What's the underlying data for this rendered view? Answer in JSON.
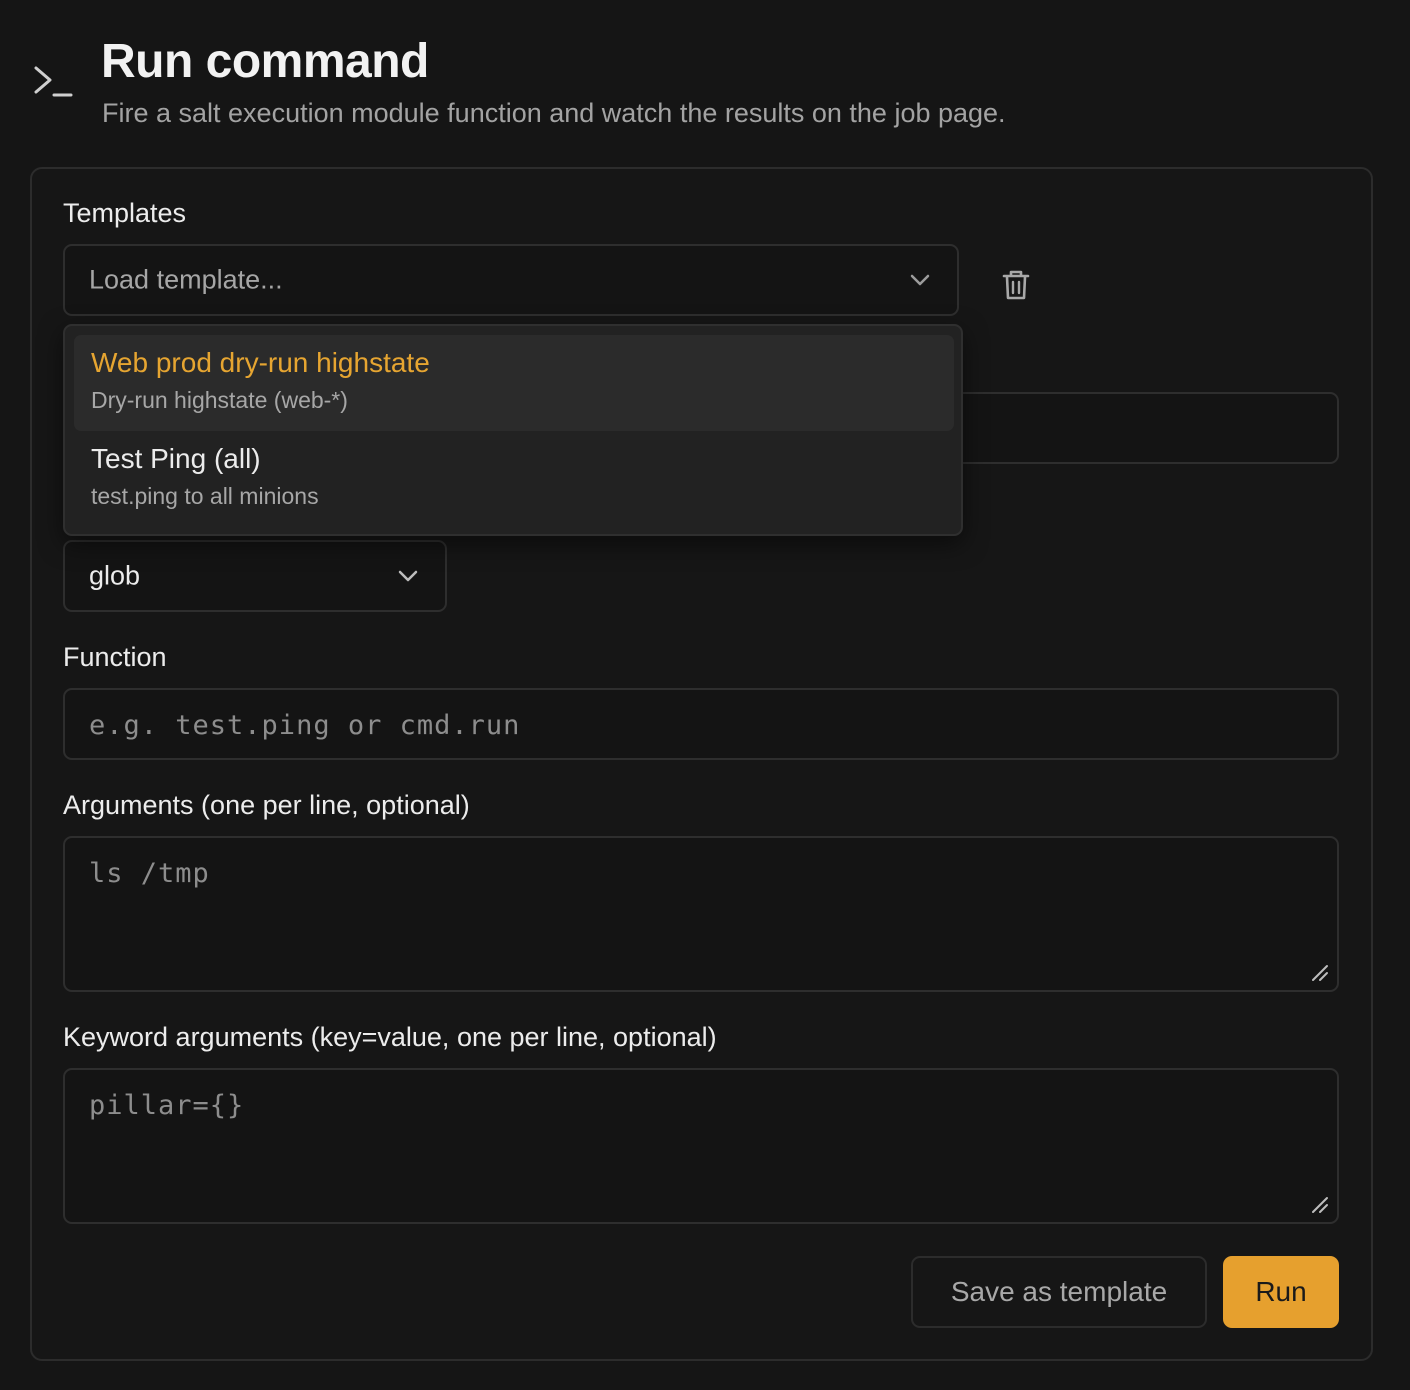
{
  "header": {
    "icon": "terminal-prompt-icon",
    "title": "Run command",
    "subtitle": "Fire a salt execution module function and watch the results on the job page."
  },
  "templates": {
    "label": "Templates",
    "select_placeholder": "Load template...",
    "delete_icon": "trash-icon",
    "dropdown_open": true,
    "options": [
      {
        "title": "Web prod dry-run highstate",
        "description": "Dry-run highstate (web-*)",
        "highlighted": true
      },
      {
        "title": "Test Ping (all)",
        "description": "test.ping to all minions",
        "highlighted": false
      }
    ]
  },
  "target_type": {
    "value": "glob"
  },
  "function": {
    "label": "Function",
    "placeholder": "e.g. test.ping or cmd.run"
  },
  "arguments": {
    "label": "Arguments (one per line, optional)",
    "placeholder": "ls /tmp"
  },
  "kwargs": {
    "label": "Keyword arguments (key=value, one per line, optional)",
    "placeholder": "pillar={}"
  },
  "actions": {
    "save_template_label": "Save as template",
    "run_label": "Run"
  },
  "colors": {
    "background": "#151515",
    "accent": "#e6a02e",
    "highlight_text": "#e6a531"
  }
}
